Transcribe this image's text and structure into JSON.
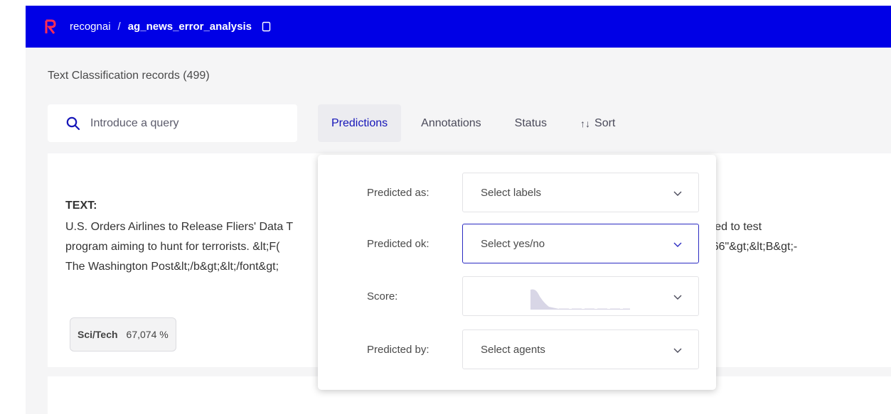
{
  "header": {
    "org": "recognai",
    "separator": "/",
    "dataset": "ag_news_error_analysis"
  },
  "records_title": "Text Classification records (499)",
  "search": {
    "placeholder": "Introduce a query"
  },
  "filters": {
    "tabs": [
      {
        "label": "Predictions",
        "active": true
      },
      {
        "label": "Annotations",
        "active": false
      },
      {
        "label": "Status",
        "active": false
      },
      {
        "label": "Sort",
        "arrows": "↑↓",
        "active": false
      }
    ]
  },
  "record": {
    "field_label": "TEXT:",
    "lines": [
      "U.S. Orders Airlines to Release Fliers' Data T",
      "program aiming to hunt for terrorists. &lt;F(",
      "The Washington Post&lt;/b&gt;&lt;/font&gt;"
    ],
    "lines_right": [
      "e used to test",
      "66666\"&gt;&lt;B&gt;-"
    ],
    "prediction": {
      "label": "Sci/Tech",
      "score": "67,074 %"
    }
  },
  "predictions_panel": {
    "rows": [
      {
        "label": "Predicted as:",
        "placeholder": "Select labels"
      },
      {
        "label": "Predicted ok:",
        "placeholder": "Select yes/no"
      },
      {
        "label": "Score:",
        "placeholder": ""
      },
      {
        "label": "Predicted by:",
        "placeholder": "Select agents"
      }
    ]
  },
  "colors": {
    "topbar": "#0000e6",
    "accent": "#1515b8",
    "logo": "#ff2d55"
  }
}
